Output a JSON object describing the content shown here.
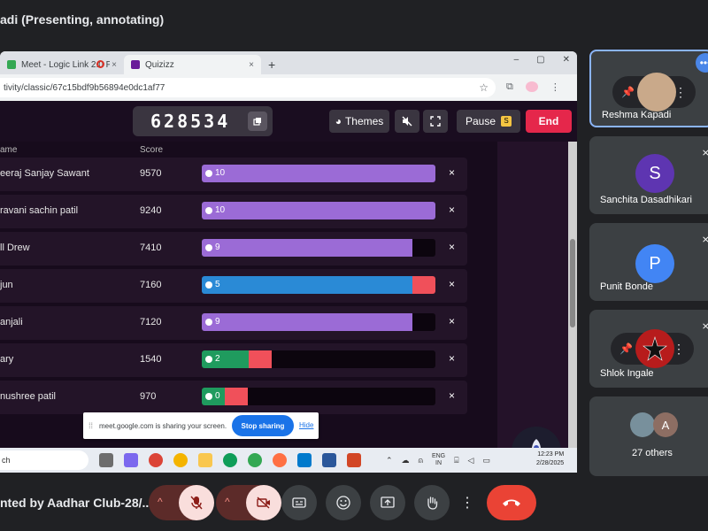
{
  "meeting": {
    "title": "adi (Presenting, annotating)",
    "bottom_label": "nted by Aadhar Club-28/..."
  },
  "browser": {
    "tabs": [
      {
        "label": "Meet - Logic Link 2.0 Prese",
        "close": "×"
      },
      {
        "label": "Quizizz",
        "close": "×"
      }
    ],
    "new_tab": "+",
    "window_controls": [
      "–",
      "▢",
      "✕"
    ],
    "url": "tivity/classic/67c15bdf9b56894e0dc1af77"
  },
  "quiz": {
    "game_code": "628534",
    "buttons": {
      "themes": "Themes",
      "pause": "Pause",
      "pause_badge": "S",
      "end": "End"
    },
    "columns": {
      "name": "ame",
      "score": "Score"
    },
    "rows": [
      {
        "name": "eeraj Sanjay Sawant",
        "score": "9570",
        "count": "10",
        "correct": 1.0,
        "wrong": 0.0,
        "color": "#9b6bd6"
      },
      {
        "name": "ravani sachin patil",
        "score": "9240",
        "count": "10",
        "correct": 1.0,
        "wrong": 0.0,
        "color": "#9b6bd6"
      },
      {
        "name": "ll Drew",
        "score": "7410",
        "count": "9",
        "correct": 0.9,
        "wrong": 0.0,
        "color": "#9b6bd6"
      },
      {
        "name": "jun",
        "score": "7160",
        "count": "5",
        "correct": 0.9,
        "wrong": 0.1,
        "color": "#2a8ad6"
      },
      {
        "name": "anjali",
        "score": "7120",
        "count": "9",
        "correct": 0.9,
        "wrong": 0.0,
        "color": "#9b6bd6"
      },
      {
        "name": "ary",
        "score": "1540",
        "count": "2",
        "correct": 0.2,
        "wrong": 0.1,
        "color": "#1f9b5e"
      },
      {
        "name": "nushree patil",
        "score": "970",
        "count": "0",
        "correct": 0.1,
        "wrong": 0.1,
        "color": "#1f9b5e"
      }
    ],
    "delete": "×"
  },
  "sharebar": {
    "message": "meet.google.com is sharing your screen.",
    "stop": "Stop sharing",
    "hide": "Hide"
  },
  "taskbar": {
    "search": "ch",
    "lang_top": "ENG",
    "lang_bottom": "IN",
    "time": "12:23 PM",
    "date": "2/28/2025"
  },
  "participants": [
    {
      "name": "Reshma Kapadi",
      "initial": ""
    },
    {
      "name": "Sanchita Dasadhikari",
      "initial": "S"
    },
    {
      "name": "Punit Bonde",
      "initial": "P"
    },
    {
      "name": "Shlok Ingale",
      "initial": ""
    },
    {
      "name": "27 others",
      "initial": "A"
    }
  ],
  "colors": {
    "accent_blue": "#1a73e8",
    "end_red": "#e5274b",
    "hangup_red": "#ea4335",
    "avatar_s": "#5e35b1",
    "avatar_p": "#4285f4"
  }
}
